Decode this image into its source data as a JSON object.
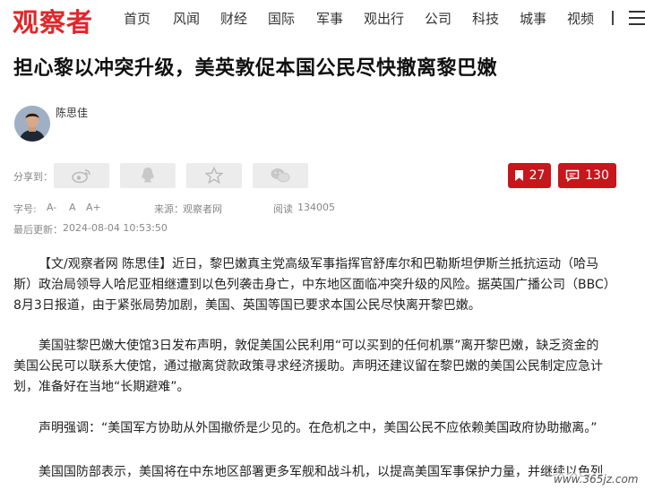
{
  "site": {
    "logo": "观察者"
  },
  "nav": [
    {
      "label": "首页"
    },
    {
      "label": "风闻"
    },
    {
      "label": "财经"
    },
    {
      "label": "国际"
    },
    {
      "label": "军事"
    },
    {
      "label": "观出行"
    },
    {
      "label": "公司"
    },
    {
      "label": "科技"
    },
    {
      "label": "城事"
    },
    {
      "label": "视频"
    }
  ],
  "article": {
    "title": "担心黎以冲突升级，美英敦促本国公民尽快撤离黎巴嫩",
    "author": "陈思佳",
    "share_label": "分享到：",
    "share_icons": [
      "weibo-icon",
      "qq-icon",
      "qzone-star-icon",
      "wechat-icon"
    ],
    "bookmark_count": "27",
    "comment_count": "130",
    "font_label": "字号:",
    "font_small": "A-",
    "font_normal": "A",
    "font_large": "A+",
    "source_label": "来源：",
    "source": "观察者网",
    "read_label": "阅读",
    "read_count": "134005",
    "updated_label": "最后更新：",
    "updated": "2024-08-04 10:53:50",
    "paragraphs": [
      {
        "lines": [
          "【文/观察者网 陈思佳】近日，黎巴嫩真主党高级军事指挥官舒库尔和巴勒斯坦伊斯兰抵抗运动（哈马",
          "斯）政治局领导人哈尼亚相继遭到以色列袭击身亡，中东地区面临冲突升级的风险。据英国广播公司（BBC）",
          "8月3日报道，由于紧张局势加剧，美国、英国等国已要求本国公民尽快离开黎巴嫩。"
        ]
      },
      {
        "lines": [
          "美国驻黎巴嫩大使馆3日发布声明，敦促美国公民利用“可以买到的任何机票”离开黎巴嫩，缺乏资金的",
          "美国公民可以联系大使馆，通过撤离贷款政策寻求经济援助。声明还建议留在黎巴嫩的美国公民制定应急计",
          "划，准备好在当地“长期避难”。"
        ]
      },
      {
        "lines": [
          "声明强调：“美国军方协助从外国撤侨是少见的。在危机之中，美国公民不应依赖美国政府协助撤离。”"
        ]
      },
      {
        "lines": [
          "美国国防部表示，美国将在中东地区部署更多军舰和战斗机，以提高美国军事保护力量，并继续以色列"
        ]
      }
    ]
  },
  "watermark": "www.365jz.com",
  "colors": {
    "brand": "#e0272b",
    "badge": "#c8161d"
  }
}
